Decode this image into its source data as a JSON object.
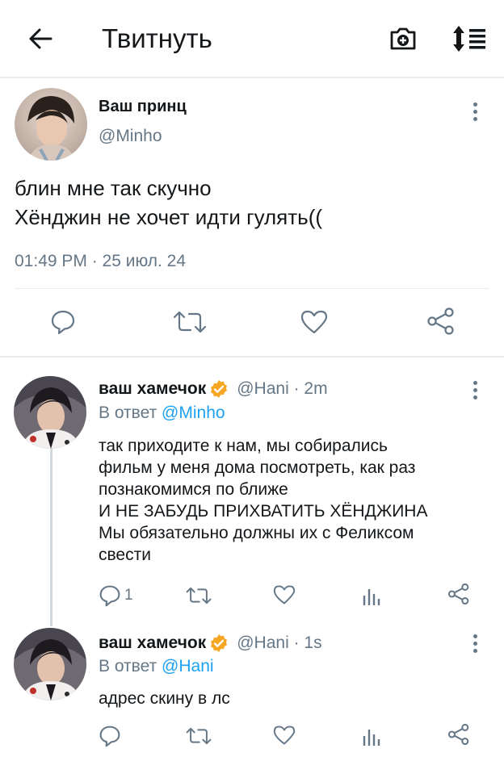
{
  "header": {
    "back_icon": "arrow-left-icon",
    "title": "Твитнуть",
    "camera_icon": "camera-plus-icon",
    "sort_icon": "sort-list-icon"
  },
  "main_tweet": {
    "name": "Ваш принц",
    "handle": "@Minho",
    "lines": [
      "блин мне так скучно",
      "Хёнджин не хочет идти гулять(("
    ],
    "timestamp": "01:49 PM · 25 июл. 24",
    "actions": [
      "reply-icon",
      "retweet-icon",
      "like-icon",
      "share-icon"
    ]
  },
  "replies": [
    {
      "name": "ваш хамечок",
      "handle_time": "@Hani · 2m",
      "reply_prefix": "В ответ",
      "reply_to": "@Minho",
      "lines": [
        "так приходите к нам, мы собирались",
        "фильм у меня дома посмотреть, как раз",
        "познакомимся по ближе",
        "И НЕ ЗАБУДЬ ПРИХВАТИТЬ ХЁНДЖИНА",
        "Мы обязательно должны их с Феликсом",
        "свести"
      ],
      "reply_count": "1"
    },
    {
      "name": "ваш хамечок",
      "handle_time": "@Hani · 1s",
      "reply_prefix": "В ответ",
      "reply_to": "@Hani",
      "lines": [
        "адрес скину в лс"
      ]
    }
  ],
  "colors": {
    "accent": "#1da1f2",
    "secondary_text": "#657786",
    "verified": "#f5a623",
    "divider": "#e6ecf0"
  }
}
